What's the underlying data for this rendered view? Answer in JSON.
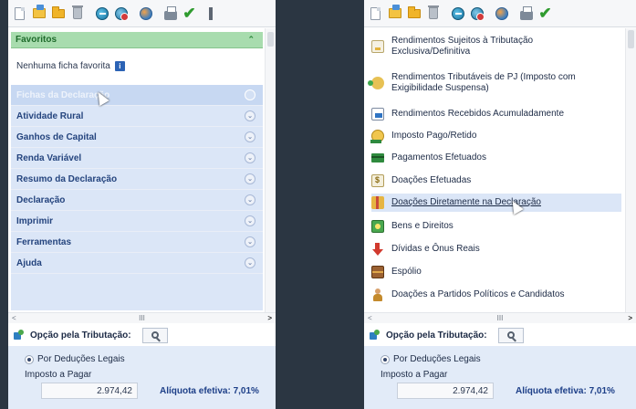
{
  "left": {
    "favorites_title": "Favoritos",
    "favorites_empty": "Nenhuma ficha favorita",
    "menu": [
      {
        "label": "Fichas da Declaração"
      },
      {
        "label": "Atividade Rural"
      },
      {
        "label": "Ganhos de Capital"
      },
      {
        "label": "Renda Variável"
      },
      {
        "label": "Resumo da Declaração"
      },
      {
        "label": "Declaração"
      },
      {
        "label": "Imprimir"
      },
      {
        "label": "Ferramentas"
      },
      {
        "label": "Ajuda"
      }
    ]
  },
  "right": {
    "fichas": [
      {
        "label": "Rendimentos Sujeitos à Tributação Exclusiva/Definitiva",
        "icon": "receipt-icon"
      },
      {
        "label": "Rendimentos Tributáveis de PJ (Imposto com Exigibilidade Suspensa)",
        "icon": "money-icon"
      },
      {
        "label": "Rendimentos Recebidos Acumuladamente",
        "icon": "document-icon"
      },
      {
        "label": "Imposto Pago/Retido",
        "icon": "coin-icon"
      },
      {
        "label": "Pagamentos Efetuados",
        "icon": "card-icon"
      },
      {
        "label": "Doações Efetuadas",
        "icon": "dollar-icon"
      },
      {
        "label": "Doações Diretamente na Declaração",
        "icon": "gift-icon"
      },
      {
        "label": "Bens e Direitos",
        "icon": "assets-icon"
      },
      {
        "label": "Dívidas e Ônus Reais",
        "icon": "debt-arrow-icon"
      },
      {
        "label": "Espólio",
        "icon": "chest-icon"
      },
      {
        "label": "Doações a Partidos Políticos e Candidatos",
        "icon": "person-icon"
      }
    ]
  },
  "common": {
    "option_label": "Opção pela Tributação:",
    "radio_label": "Por Deduções Legais",
    "imposto_label": "Imposto a Pagar",
    "imposto_value": "2.974,42",
    "aliquota": "Alíquota efetiva: 7,01%",
    "hscroll_mid": "III"
  },
  "colors": {
    "favorites_header": "#a8dcae",
    "menu_bg": "#dbe6f7",
    "menu_text": "#24447e",
    "bottom_bg": "#e2ebf8",
    "aliquota_text": "#1d3f88"
  }
}
